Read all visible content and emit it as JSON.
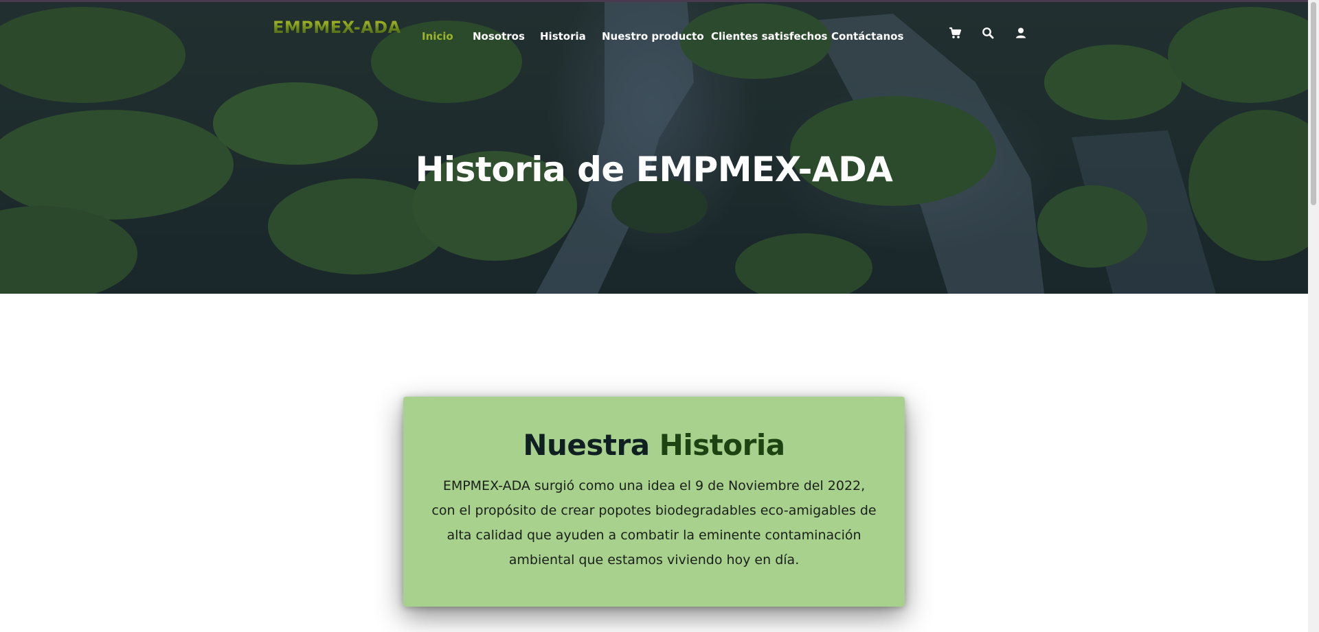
{
  "brand": {
    "logo_text": "EMPMEX-ADA"
  },
  "nav": {
    "items": [
      {
        "label": "Inicio",
        "active": true
      },
      {
        "label": "Nosotros",
        "active": false
      },
      {
        "label": "Historia",
        "active": false
      },
      {
        "label": "Nuestro producto",
        "active": false
      },
      {
        "label": "Clientes satisfechos",
        "active": false
      },
      {
        "label": "Contáctanos",
        "active": false
      }
    ],
    "icons": [
      "cart-icon",
      "search-icon",
      "user-icon"
    ]
  },
  "hero": {
    "title": "Historia de EMPMEX-ADA"
  },
  "history": {
    "title_part1": "Nuestra",
    "title_part2": "Historia",
    "body": "EMPMEX-ADA surgió como una idea el 9 de Noviembre del 2022, con el propósito de crear popotes biodegradables eco-amigables de alta calidad que ayuden a combatir la eminente contaminación ambiental que estamos viviendo hoy en día."
  },
  "colors": {
    "nav_active": "#9cb52a",
    "card_background": "#a8d18d",
    "title_dark": "#0f1f22",
    "title_accent": "#1c4311"
  }
}
